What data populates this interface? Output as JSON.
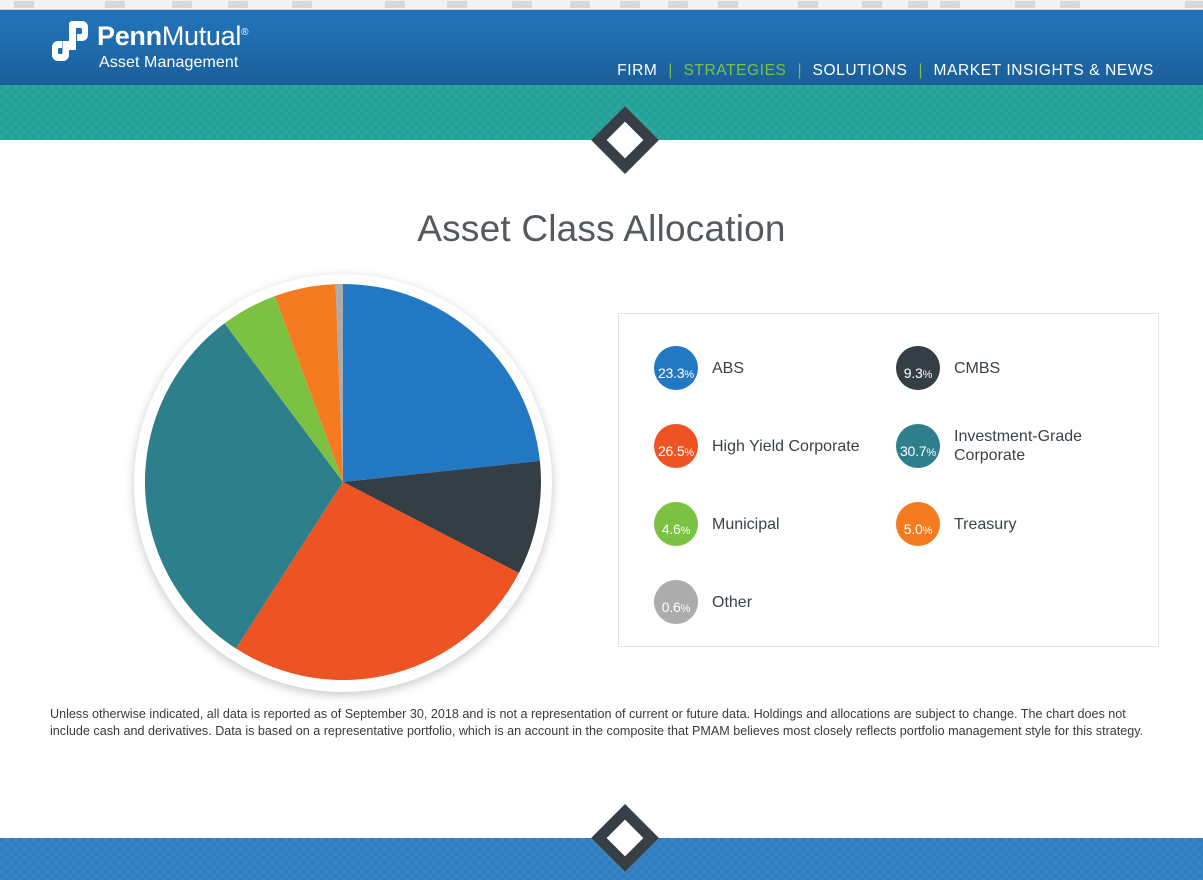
{
  "browser_chrome": {
    "visible": true
  },
  "header": {
    "brand": {
      "logo_icon": "penn-mutual-dp-monogram",
      "name_bold": "Penn",
      "name_light": "Mutual",
      "registered_mark": "®",
      "subtitle": "Asset Management"
    },
    "nav": {
      "separator": "|",
      "items": [
        {
          "label": "FIRM",
          "active": false
        },
        {
          "label": "STRATEGIES",
          "active": true
        },
        {
          "label": "SOLUTIONS",
          "active": false
        },
        {
          "label": "MARKET INSIGHTS & NEWS",
          "active": false
        }
      ]
    },
    "colors": {
      "background_top": "#2274B8",
      "background_bottom": "#1A5E99",
      "active_nav": "#7CC242"
    }
  },
  "bands": {
    "teal_color": "#22A198",
    "blue_color": "#2E7CC0",
    "diamond_border_color": "#373F45",
    "diamond_fill_color": "#FFFFFF"
  },
  "page_title": "Asset Class Allocation",
  "chart_data": {
    "type": "pie",
    "title": "Asset Class Allocation",
    "legend_position": "right",
    "start_angle_deg": 0,
    "direction": "clockwise",
    "units": "percent",
    "categories": [
      "ABS",
      "CMBS",
      "High Yield Corporate",
      "Investment-Grade Corporate",
      "Municipal",
      "Treasury",
      "Other"
    ],
    "values": [
      23.3,
      9.3,
      26.5,
      30.7,
      4.6,
      5.0,
      0.6
    ],
    "colors": [
      "#2378C3",
      "#333E45",
      "#EE5323",
      "#2E7F8C",
      "#7CC242",
      "#F47B20",
      "#ACACAC"
    ],
    "slice_order_clockwise_from_12": [
      {
        "label": "ABS",
        "value": 23.3,
        "color": "#2378C3"
      },
      {
        "label": "CMBS",
        "value": 9.3,
        "color": "#333E45"
      },
      {
        "label": "High Yield Corporate",
        "value": 26.5,
        "color": "#EE5323"
      },
      {
        "label": "Investment-Grade Corporate",
        "value": 30.7,
        "color": "#2E7F8C"
      },
      {
        "label": "Municipal",
        "value": 4.6,
        "color": "#7CC242"
      },
      {
        "label": "Treasury",
        "value": 5.0,
        "color": "#F47B20"
      },
      {
        "label": "Other",
        "value": 0.6,
        "color": "#ACACAC"
      }
    ]
  },
  "legend": {
    "columns": [
      {
        "items": [
          {
            "pct": "23.3",
            "pct_symbol": "%",
            "label": "ABS",
            "color": "#2378C3"
          },
          {
            "pct": "26.5",
            "pct_symbol": "%",
            "label": "High Yield Corporate",
            "color": "#EE5323"
          },
          {
            "pct": "4.6",
            "pct_symbol": "%",
            "label": "Municipal",
            "color": "#7CC242"
          },
          {
            "pct": "0.6",
            "pct_symbol": "%",
            "label": "Other",
            "color": "#ACACAC"
          }
        ]
      },
      {
        "items": [
          {
            "pct": "9.3",
            "pct_symbol": "%",
            "label": "CMBS",
            "color": "#333E45"
          },
          {
            "pct": "30.7",
            "pct_symbol": "%",
            "label": "Investment-Grade Corporate",
            "color": "#2E7F8C"
          },
          {
            "pct": "5.0",
            "pct_symbol": "%",
            "label": "Treasury",
            "color": "#F47B20"
          }
        ]
      }
    ]
  },
  "footnote": "Unless otherwise indicated, all data is reported as of September 30, 2018 and is not a representation of current or future data. Holdings and allocations are subject to change. The chart does not include cash and derivatives. Data is based on a representative portfolio, which is an account in the composite that PMAM believes most closely reflects portfolio management style for this strategy."
}
